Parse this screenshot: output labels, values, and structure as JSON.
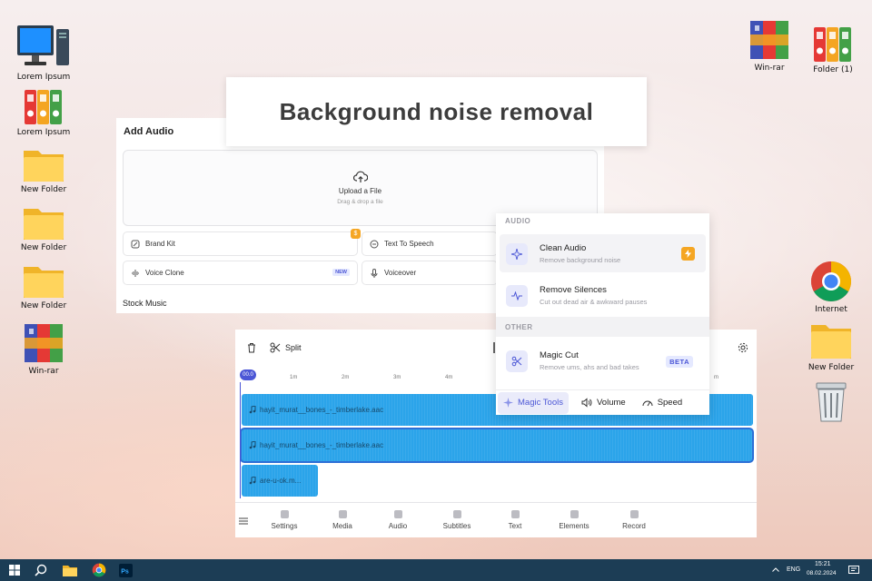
{
  "desktop": {
    "left_icons": [
      {
        "label": "Lorem Ipsum",
        "icon": "computer-icon"
      },
      {
        "label": "Lorem Ipsum",
        "icon": "binders-icon"
      },
      {
        "label": "New Folder",
        "icon": "folder-icon"
      },
      {
        "label": "New Folder",
        "icon": "folder-icon"
      },
      {
        "label": "New Folder",
        "icon": "folder-icon"
      },
      {
        "label": "Win-rar",
        "icon": "winrar-icon"
      }
    ],
    "right_icons": [
      {
        "label": "Win-rar",
        "icon": "winrar-icon"
      },
      {
        "label": "Folder (1)",
        "icon": "binders-icon"
      },
      {
        "label": "Internet",
        "icon": "chrome-icon"
      },
      {
        "label": "New Folder",
        "icon": "folder-icon"
      },
      {
        "label": "",
        "icon": "recycle-bin-icon"
      }
    ]
  },
  "banner": {
    "title": "Background noise removal"
  },
  "add_audio": {
    "title": "Add Audio",
    "upload_title": "Upload a File",
    "upload_hint": "Drag & drop a file",
    "options": [
      {
        "label": "Brand Kit",
        "badge": ""
      },
      {
        "label": "Text To Speech",
        "badge": ""
      },
      {
        "label": "Voice Clone",
        "badge": "NEW"
      },
      {
        "label": "Voiceover",
        "badge": ""
      }
    ],
    "stock_music": "Stock Music"
  },
  "magic_menu": {
    "audio_header": "AUDIO",
    "other_header": "OTHER",
    "items": [
      {
        "name": "Clean Audio",
        "desc": "Remove background noise",
        "badge": "lightning-icon"
      },
      {
        "name": "Remove Silences",
        "desc": "Cut out dead air & awkward pauses",
        "badge": ""
      },
      {
        "name": "Magic Cut",
        "desc": "Remove ums, ahs and bad takes",
        "badge": "BETA"
      }
    ],
    "toolbar": {
      "magic_tools": "Magic Tools",
      "volume": "Volume",
      "speed": "Speed"
    }
  },
  "editor": {
    "split_label": "Split",
    "playhead": "00.0",
    "ticks": [
      "1m",
      "2m",
      "3m",
      "4m",
      "m"
    ],
    "tracks": [
      {
        "label": "hayit_murat__bones_-_timberlake.aac"
      },
      {
        "label": "hayit_murat__bones_-_timberlake.aac"
      },
      {
        "label": "are-u-ok.m..."
      }
    ],
    "nav": [
      "Settings",
      "Media",
      "Audio",
      "Subtitles",
      "Text",
      "Elements",
      "Record"
    ]
  },
  "taskbar": {
    "language": "ENG",
    "time": "15:21",
    "date": "08.02.2024"
  },
  "colors": {
    "accent": "#4c57d6",
    "track": "#2ba4ea",
    "taskbar": "#1c3d55",
    "pro": "#f5a623"
  }
}
